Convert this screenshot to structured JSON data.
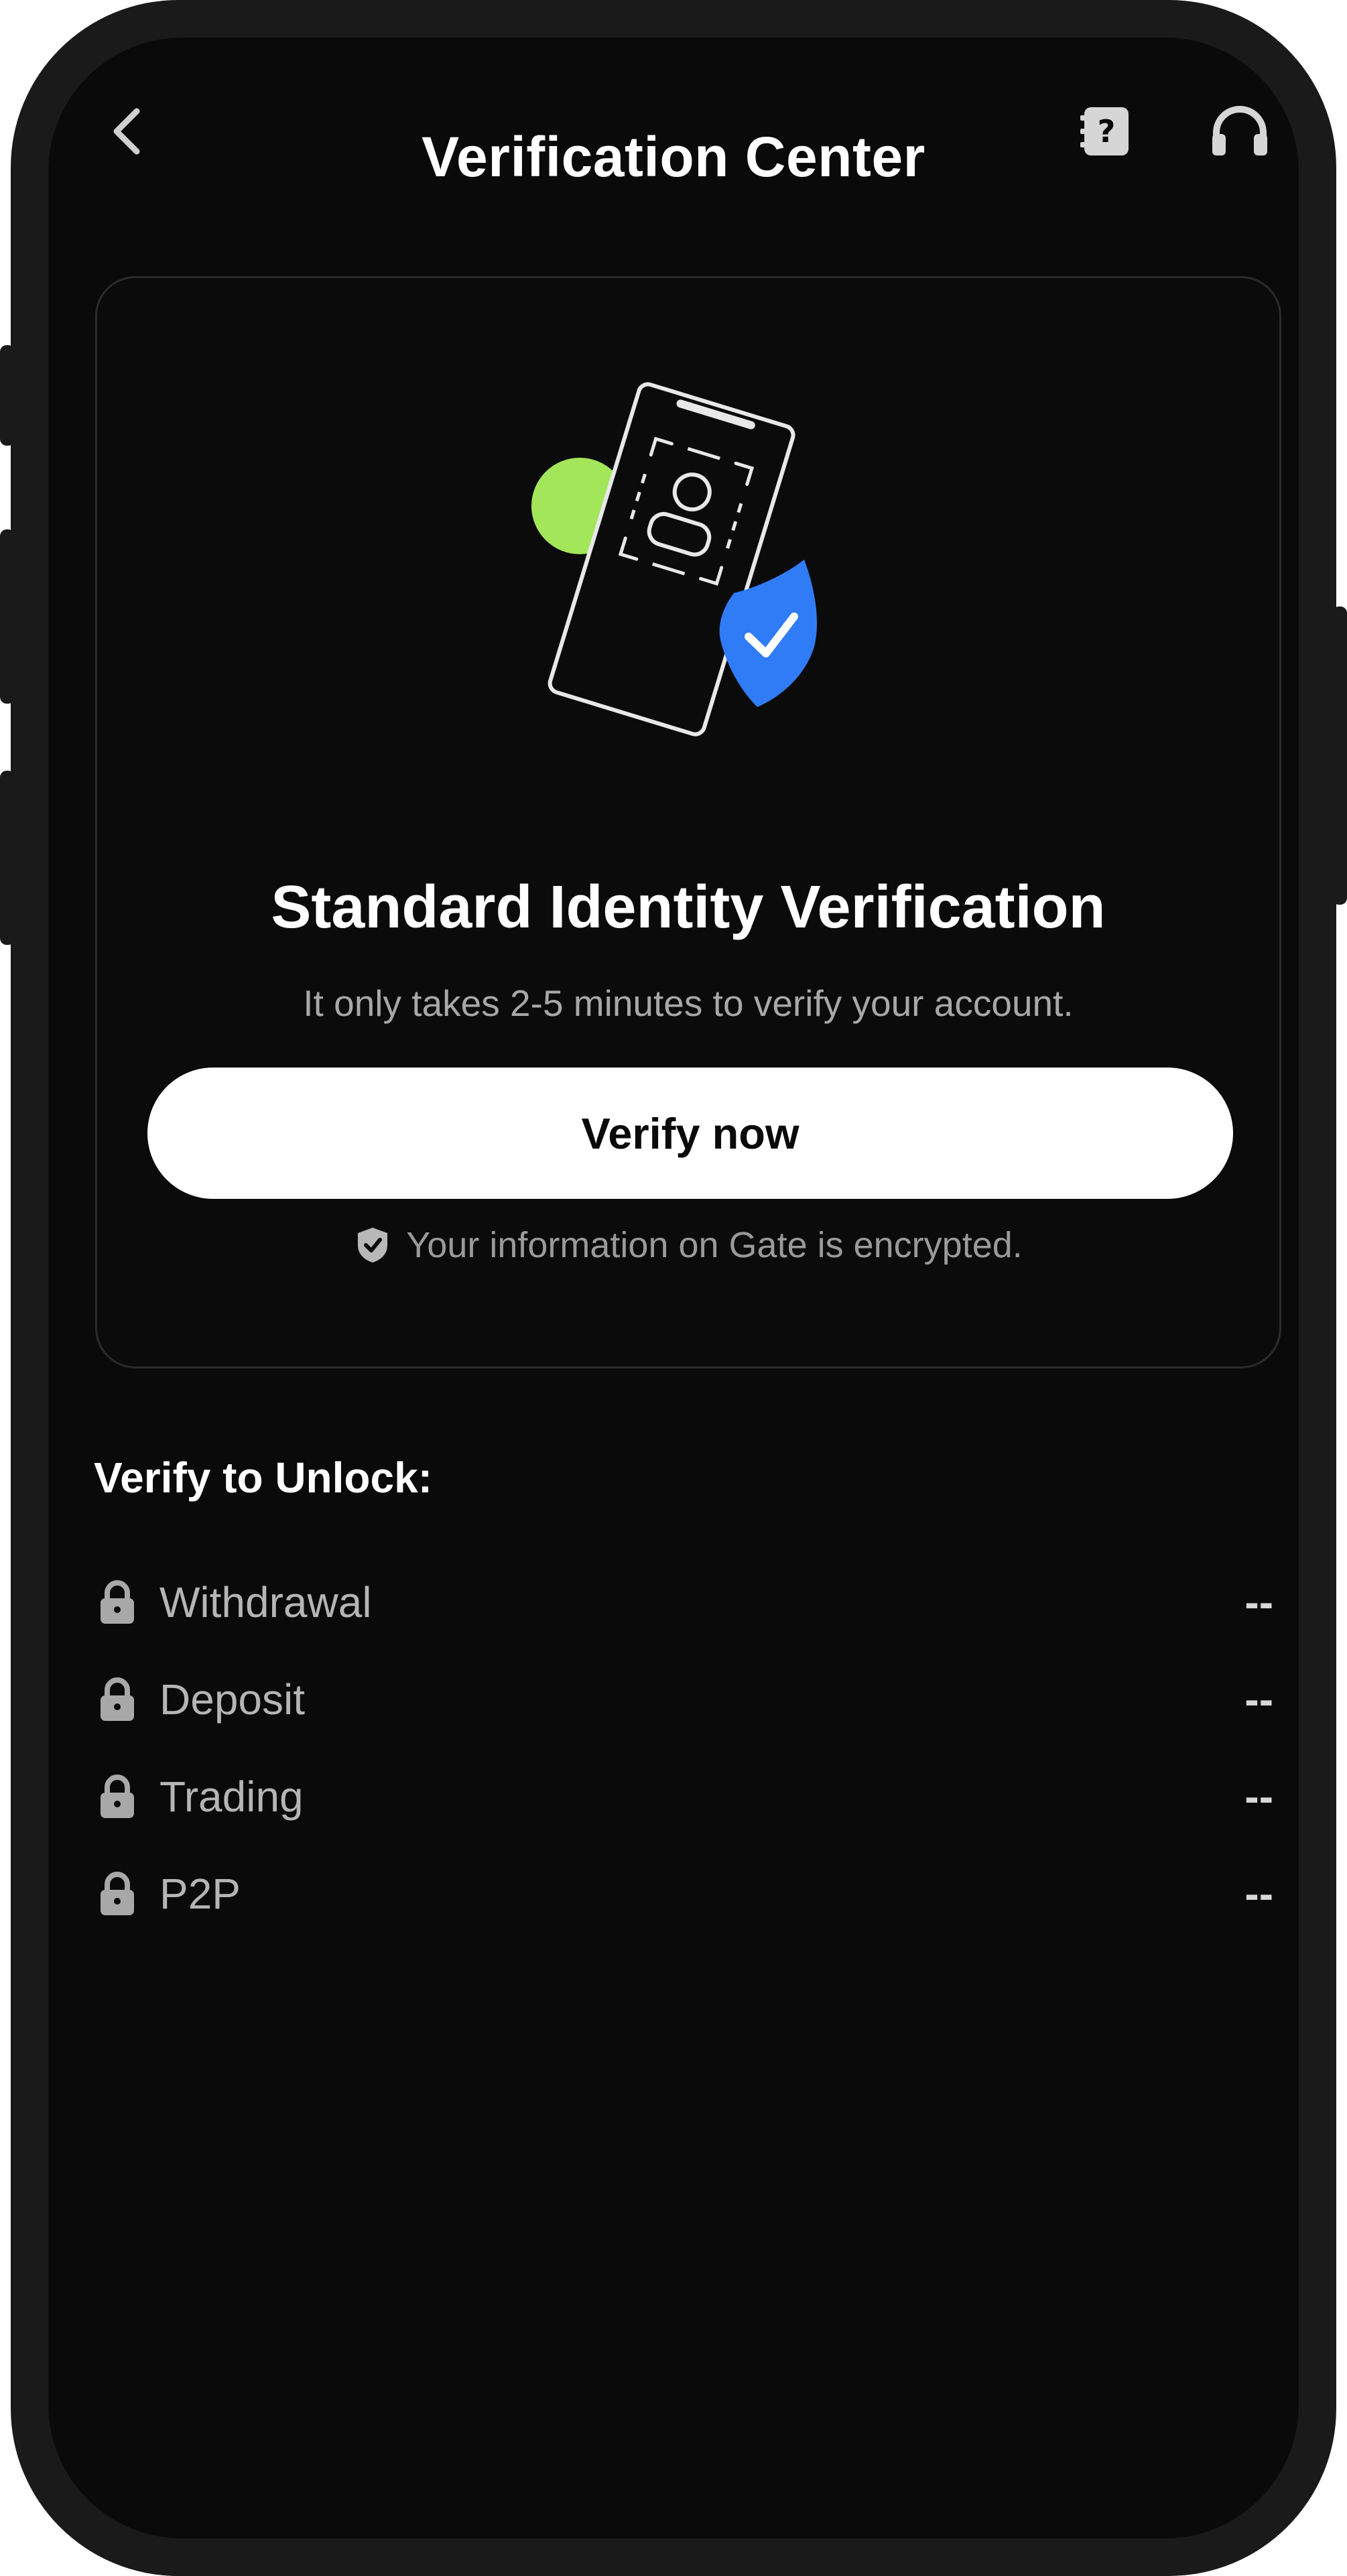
{
  "header": {
    "title": "Verification Center",
    "back_icon": "chevron-left-icon",
    "help_icon": "help-book-icon",
    "support_icon": "headset-icon"
  },
  "card": {
    "title": "Standard Identity Verification",
    "subtitle": "It only takes 2-5 minutes to verify your account.",
    "button_label": "Verify now",
    "encrypted_note": "Your information on Gate is encrypted.",
    "note_icon": "shield-check-icon",
    "illustration_icon": "id-card-shield-icon"
  },
  "unlock": {
    "heading": "Verify to Unlock:",
    "items": [
      {
        "label": "Withdrawal",
        "value": "--"
      },
      {
        "label": "Deposit",
        "value": "--"
      },
      {
        "label": "Trading",
        "value": "--"
      },
      {
        "label": "P2P",
        "value": "--"
      }
    ]
  },
  "colors": {
    "background": "#0a0a0a",
    "accent_green": "#a3e65a",
    "accent_blue": "#2f7cf6",
    "button_bg": "#ffffff",
    "muted_text": "#a8a8a8"
  }
}
